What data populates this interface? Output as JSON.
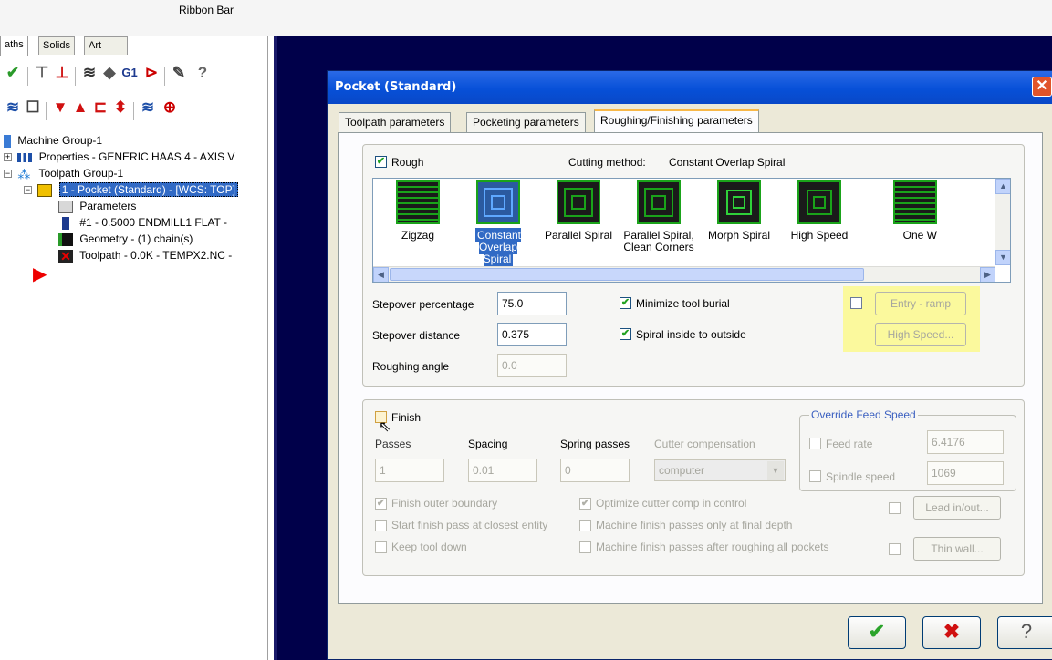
{
  "ribbon": {
    "title": "Ribbon Bar"
  },
  "manager": {
    "tabs": [
      "aths",
      "Solids",
      "Art"
    ],
    "tree": [
      "Machine Group-1",
      "Properties - GENERIC HAAS 4 - AXIS V",
      "Toolpath Group-1",
      "1 - Pocket (Standard) - [WCS: TOP]",
      "Parameters",
      "#1 - 0.5000 ENDMILL1 FLAT -",
      "Geometry - (1) chain(s)",
      "Toolpath - 0.0K - TEMPX2.NC -"
    ],
    "toolbar_g1": "G1"
  },
  "dialog": {
    "title": "Pocket (Standard)",
    "close": "✕",
    "tabs": [
      "Toolpath parameters",
      "Pocketing parameters",
      "Roughing/Finishing parameters"
    ],
    "rough": {
      "label": "Rough",
      "checked": "✔",
      "cutting_method_label": "Cutting method:",
      "cutting_method_value": "Constant Overlap Spiral",
      "methods": [
        "Zigzag",
        "Constant Overlap Spiral",
        "Parallel Spiral",
        "Parallel Spiral, Clean Corners",
        "Morph Spiral",
        "High Speed",
        "One W"
      ],
      "stepover_pct_label": "Stepover percentage",
      "stepover_pct": "75.0",
      "stepover_dist_label": "Stepover distance",
      "stepover_dist": "0.375",
      "roughing_angle_label": "Roughing angle",
      "roughing_angle": "0.0",
      "minimize_burial": "Minimize tool burial",
      "spiral_inside": "Spiral inside to outside",
      "entry_ramp": "Entry - ramp",
      "high_speed_btn": "High Speed..."
    },
    "finish": {
      "label": "Finish",
      "passes_label": "Passes",
      "spacing_label": "Spacing",
      "spring_label": "Spring passes",
      "cutter_comp_label": "Cutter compensation",
      "passes": "1",
      "spacing": "0.01",
      "spring": "0",
      "cutter_comp": "computer",
      "finish_outer": "Finish outer boundary",
      "start_closest": "Start finish pass at closest entity",
      "keep_down": "Keep tool down",
      "optimize_comp": "Optimize cutter comp in control",
      "final_depth": "Machine finish passes only at final depth",
      "after_roughing": "Machine finish passes after roughing all pockets",
      "override_legend": "Override Feed Speed",
      "feed_rate_label": "Feed rate",
      "feed_rate": "6.4176",
      "spindle_label": "Spindle speed",
      "spindle": "1069",
      "lead_btn": "Lead in/out...",
      "thin_btn": "Thin wall..."
    },
    "buttons": {
      "ok": "✔",
      "cancel": "✖",
      "help": "?"
    }
  },
  "colors": {
    "accent": "#316ac5",
    "graphics_bg": "#00004a",
    "highlight": "#fbf99d"
  }
}
